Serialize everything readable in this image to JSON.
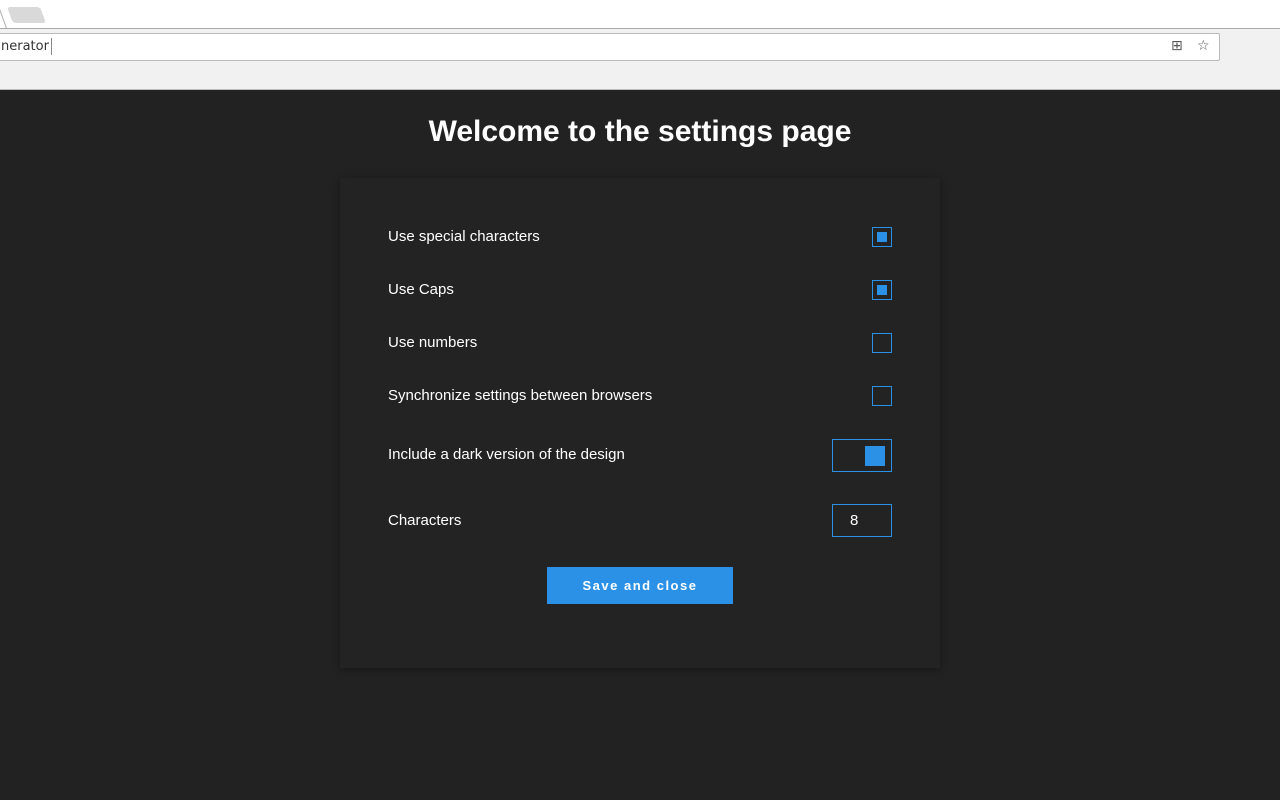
{
  "browser": {
    "url_fragment": "nerator",
    "icons": [
      "translate-icon",
      "star-icon"
    ]
  },
  "page": {
    "title": "Welcome to the settings page"
  },
  "settings": [
    {
      "label": "Use special characters",
      "checked": true
    },
    {
      "label": "Use Caps",
      "checked": true
    },
    {
      "label": "Use numbers",
      "checked": false
    },
    {
      "label": "Synchronize settings between browsers",
      "checked": false
    }
  ],
  "dark_toggle": {
    "label": "Include a dark version of the design",
    "on": true
  },
  "characters": {
    "label": "Characters",
    "value": "8"
  },
  "save_label": "Save and close",
  "colors": {
    "accent": "#2a91e6",
    "background": "#222222"
  }
}
